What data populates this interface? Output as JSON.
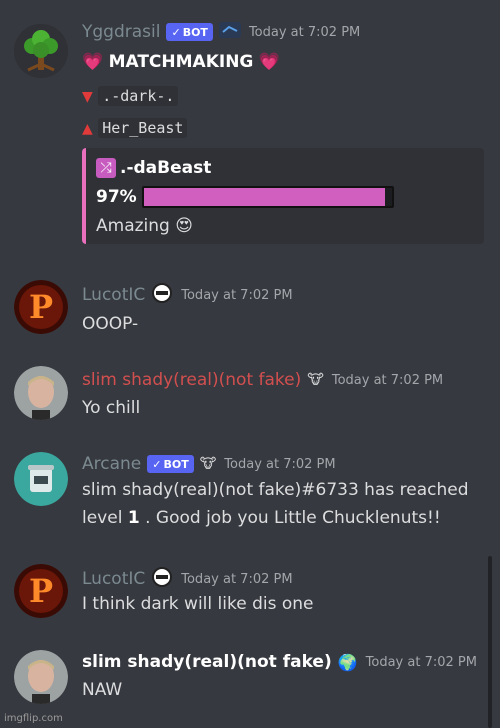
{
  "messages": [
    {
      "username": "Yggdrasil",
      "username_color": "#7b8a90",
      "bot_badge": "BOT",
      "timestamp": "Today at 7:02 PM",
      "lines": [
        "MATCHMAKING",
        ".-dark-.",
        "Her_Beast"
      ],
      "embed": {
        "title": ".-daBeast",
        "percent_label": "97%",
        "percent": 97,
        "verdict": "Amazing 😍"
      }
    },
    {
      "username": "LucotIC",
      "username_color": "#7b8a90",
      "timestamp": "Today at 7:02 PM",
      "text": "OOOP-"
    },
    {
      "username": "slim shady(real)(not fake)",
      "username_color": "#d34f4f",
      "timestamp": "Today at 7:02 PM",
      "text": "Yo chill"
    },
    {
      "username": "Arcane",
      "username_color": "#7b8a90",
      "bot_badge": "BOT",
      "timestamp": "Today at 7:02 PM",
      "text_line1": "slim shady(real)(not fake)#6733 has reached",
      "text_line2_prefix": "level ",
      "text_line2_level": "1",
      "text_line2_suffix": " . Good job you Little Chucklenuts!!"
    },
    {
      "username": "LucotIC",
      "username_color": "#7b8a90",
      "timestamp": "Today at 7:02 PM",
      "text": "I think dark will like dis one"
    },
    {
      "username": "slim shady(real)(not fake)",
      "username_color": "#ffffff",
      "timestamp": "Today at 7:02 PM",
      "text": "NAW"
    }
  ],
  "footer": "imgflip.com",
  "colors": {
    "background": "#36393f",
    "embed_accent": "#e970bd",
    "bar_fill": "#d05fc0",
    "bot_badge": "#5865f2"
  },
  "icons": [
    "tree-avatar",
    "pink-heart-icon",
    "red-down-triangle-icon",
    "red-up-triangle-icon",
    "shuffle-icon",
    "heart-eyes-emoji",
    "role-badge-icon",
    "fire-p-avatar",
    "eminem-avatar",
    "bucket-avatar",
    "globe-icon"
  ]
}
